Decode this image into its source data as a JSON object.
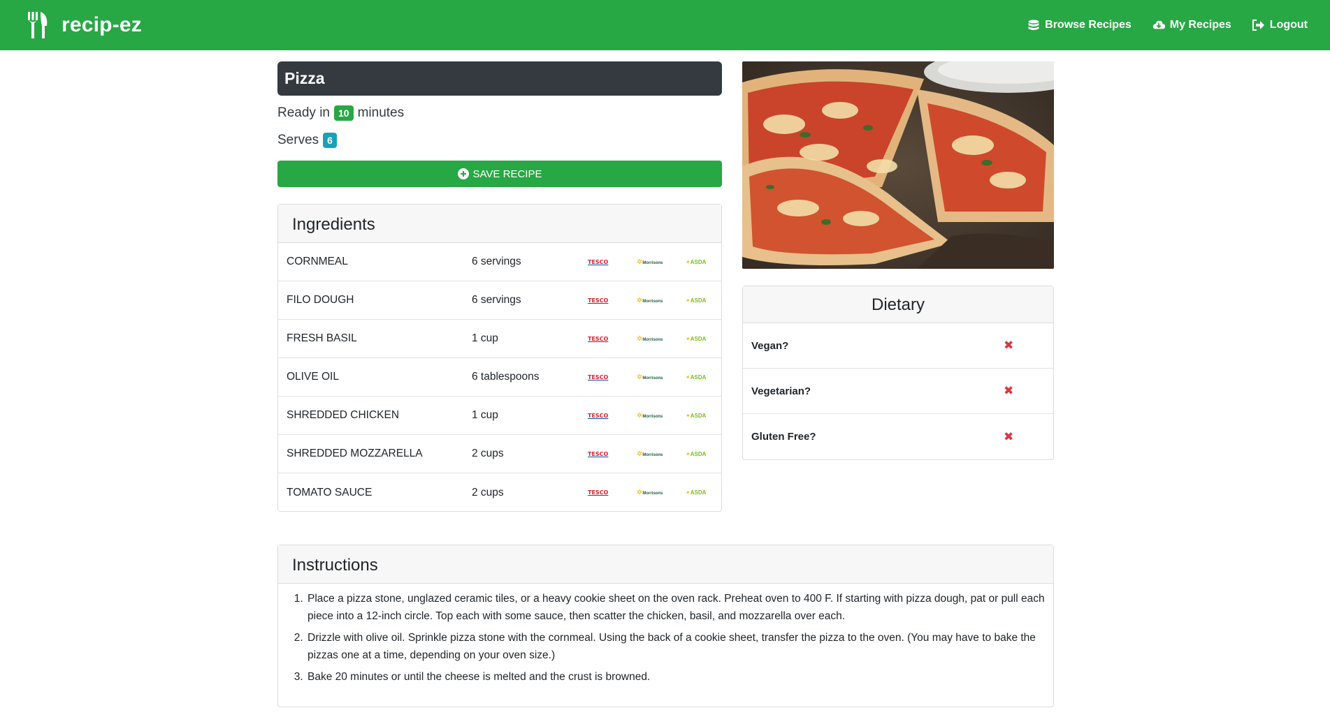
{
  "brand": {
    "name": "recip-ez",
    "icon": "utensils-icon"
  },
  "nav": [
    {
      "label": "Browse Recipes",
      "icon": "database-icon"
    },
    {
      "label": "My Recipes",
      "icon": "cloud-download-icon"
    },
    {
      "label": "Logout",
      "icon": "sign-out-icon"
    }
  ],
  "recipe": {
    "title": "Pizza",
    "ready_prefix": "Ready in",
    "ready_minutes": "10",
    "ready_suffix": "minutes",
    "serves_label": "Serves",
    "serves": "6",
    "save_label": "SAVE RECIPE"
  },
  "ingredients": {
    "heading": "Ingredients",
    "shops": [
      "TESCO",
      "Morrisons",
      "ASDA"
    ],
    "items": [
      {
        "name": "CORNMEAL",
        "qty": "6 servings"
      },
      {
        "name": "FILO DOUGH",
        "qty": "6 servings"
      },
      {
        "name": "FRESH BASIL",
        "qty": "1 cup"
      },
      {
        "name": "OLIVE OIL",
        "qty": "6 tablespoons"
      },
      {
        "name": "SHREDDED CHICKEN",
        "qty": "1 cup"
      },
      {
        "name": "SHREDDED MOZZARELLA",
        "qty": "2 cups"
      },
      {
        "name": "TOMATO SAUCE",
        "qty": "2 cups"
      }
    ]
  },
  "dietary": {
    "heading": "Dietary",
    "items": [
      {
        "label": "Vegan?",
        "value": "✖"
      },
      {
        "label": "Vegetarian?",
        "value": "✖"
      },
      {
        "label": "Gluten Free?",
        "value": "✖"
      }
    ]
  },
  "instructions": {
    "heading": "Instructions",
    "steps": [
      "Place a pizza stone, unglazed ceramic tiles, or a heavy cookie sheet on the oven rack. Preheat oven to 400 F. If starting with pizza dough, pat or pull each piece into a 12-inch circle. Top each with some sauce, then scatter the chicken, basil, and mozzarella over each.",
      "Drizzle with olive oil. Sprinkle pizza stone with the cornmeal. Using the back of a cookie sheet, transfer the pizza to the oven. (You may have to bake the pizzas one at a time, depending on your oven size.)",
      "Bake 20 minutes or until the cheese is melted and the crust is browned."
    ]
  },
  "colors": {
    "primary": "#28a745",
    "dark": "#343a40",
    "info": "#17a2b8",
    "danger": "#dc3545"
  }
}
